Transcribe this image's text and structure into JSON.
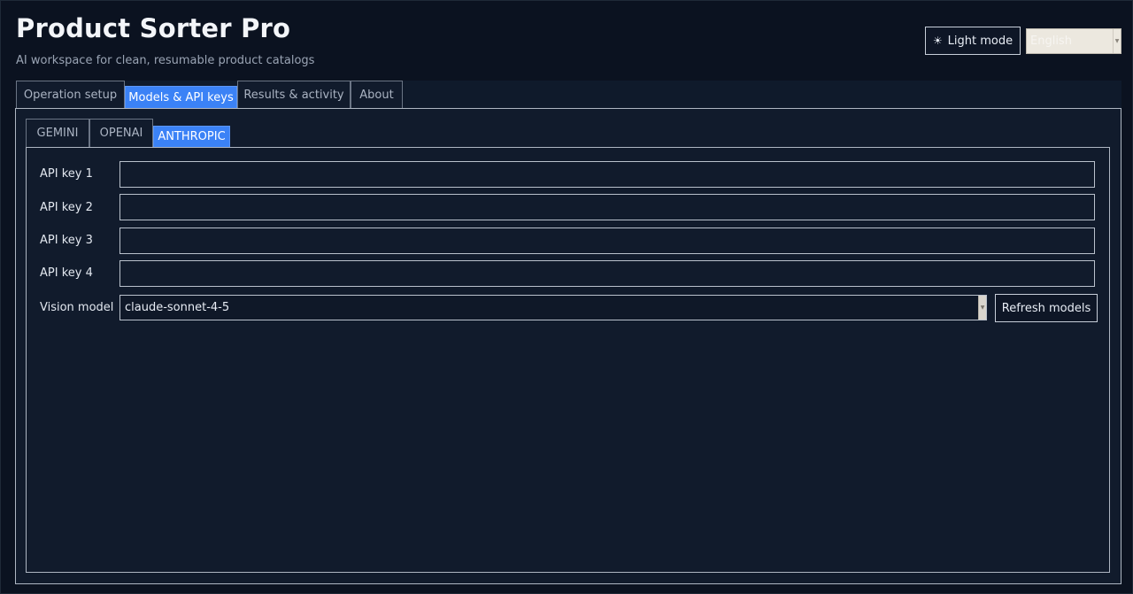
{
  "header": {
    "title": "Product Sorter Pro",
    "subtitle": "AI workspace for clean, resumable product catalogs",
    "theme_icon": "sun-icon",
    "theme_glyph": "☀",
    "theme_label": "Light mode",
    "language_selected": "English"
  },
  "main_tabs": [
    {
      "label": "Operation setup"
    },
    {
      "label": "Models & API keys",
      "active": true
    },
    {
      "label": "Results & activity"
    },
    {
      "label": "About"
    }
  ],
  "provider_tabs": [
    {
      "label": "GEMINI"
    },
    {
      "label": "OPENAI"
    },
    {
      "label": "ANTHROPIC",
      "active": true
    }
  ],
  "form": {
    "api_keys": [
      {
        "label": "API key 1",
        "value": ""
      },
      {
        "label": "API key 2",
        "value": ""
      },
      {
        "label": "API key 3",
        "value": ""
      },
      {
        "label": "API key 4",
        "value": ""
      }
    ],
    "vision_model_label": "Vision model",
    "vision_model_value": "claude-sonnet-4-5",
    "refresh_label": "Refresh models"
  },
  "colors": {
    "background": "#0b1220",
    "panel": "#111b2c",
    "accent": "#3b82f6"
  }
}
